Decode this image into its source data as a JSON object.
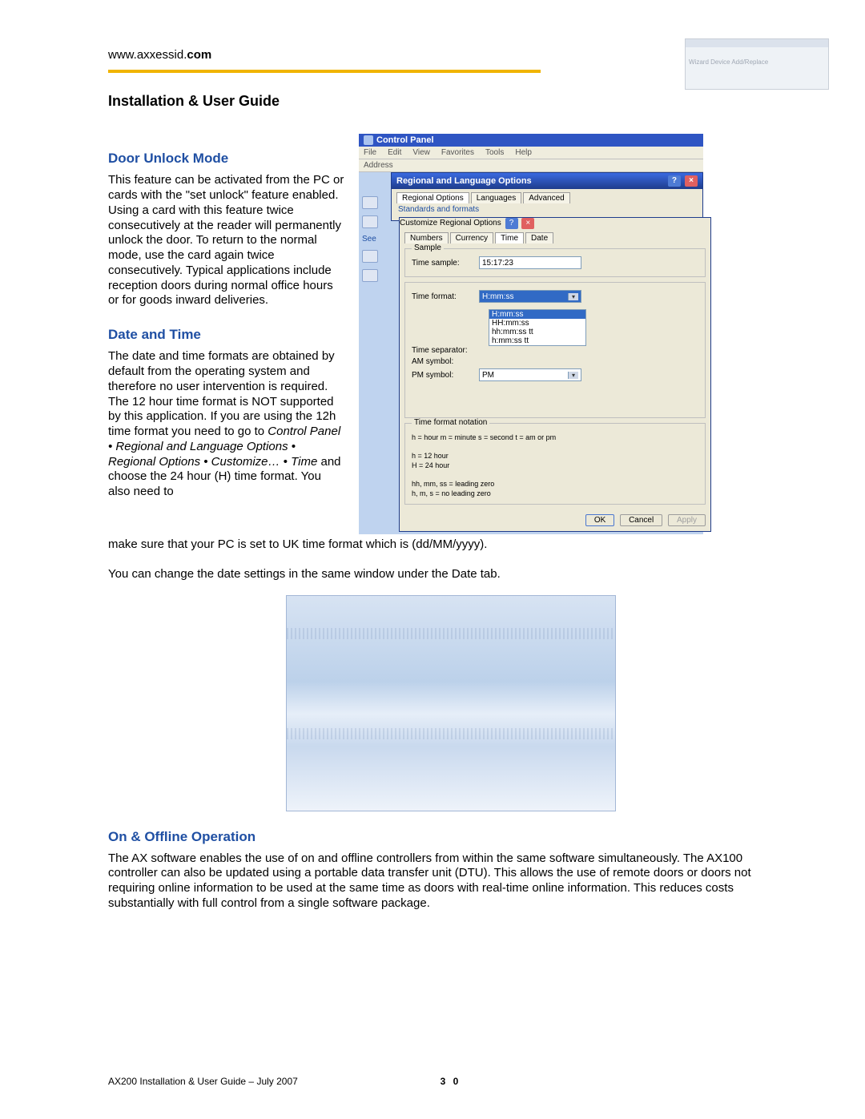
{
  "header": {
    "url_left": "www.axxessid.",
    "url_bold": "com",
    "thumb_line1": "Wizard Device Add/Replace"
  },
  "title": "Installation & User Guide",
  "s1": {
    "heading": "Door Unlock Mode",
    "text": "This feature can be activated from the PC or cards with the \"set unlock\" feature enabled. Using a card with this feature twice consecutively at the reader will permanently unlock the door. To return to the normal mode, use the card again twice consecutively. Typical applications include reception doors during normal office hours or for goods inward deliveries."
  },
  "s2": {
    "heading": "Date and Time",
    "text_a": "The date and time formats are obtained by default from the operating system and therefore no user intervention is required. The 12 hour time format is NOT supported by this application. If you are using the 12h time format you need to go to ",
    "text_ital": "Control Panel • Regional and Language Options • Regional Options • Customize… • Time",
    "text_b": " and choose the 24 hour (H) time format. You also need to",
    "text_full": "make sure that your PC is set to UK time format which is (dd/MM/yyyy).",
    "text_under_full": "You can change the date settings in the same window under the Date tab."
  },
  "s3": {
    "heading": "On & Offline Operation",
    "text": "The AX software enables the use of on and offline controllers from within the same software simultaneously.  The AX100 controller can also be updated using a portable data transfer unit (DTU).  This allows the use of remote doors or doors not requiring online information to be used at the same time as doors with real-time online information.  This reduces costs substantially with full control from a single software package."
  },
  "cp": {
    "title": "Control Panel",
    "menu": [
      "File",
      "Edit",
      "View",
      "Favorites",
      "Tools",
      "Help"
    ],
    "address_label": "Address",
    "see": "See",
    "reg_title": "Regional and Language Options",
    "reg_tabs": [
      "Regional Options",
      "Languages",
      "Advanced"
    ],
    "reg_group": "Standards and formats",
    "cust_title": "Customize Regional Options",
    "cust_tabs": [
      "Numbers",
      "Currency",
      "Time",
      "Date"
    ],
    "sample_legend": "Sample",
    "sample_label": "Time sample:",
    "sample_value": "15:17:23",
    "fmt_label": "Time format:",
    "fmt_value": "H:mm:ss",
    "fmt_options": [
      "H:mm:ss",
      "HH:mm:ss",
      "hh:mm:ss tt",
      "h:mm:ss tt"
    ],
    "sep_label": "Time separator:",
    "am_label": "AM symbol:",
    "pm_label": "PM symbol:",
    "pm_value": "PM",
    "notation_legend": "Time format notation",
    "notation1": "h = hour   m = minute   s = second   t = am or pm",
    "notation2": "h = 12 hour",
    "notation3": "H = 24 hour",
    "notation4": "hh, mm, ss = leading zero",
    "notation5": "h, m, s = no leading zero",
    "btn_ok": "OK",
    "btn_cancel": "Cancel",
    "btn_apply": "Apply"
  },
  "footer": {
    "left": "AX200 Installation & User Guide – July 2007",
    "page": "3 0"
  }
}
